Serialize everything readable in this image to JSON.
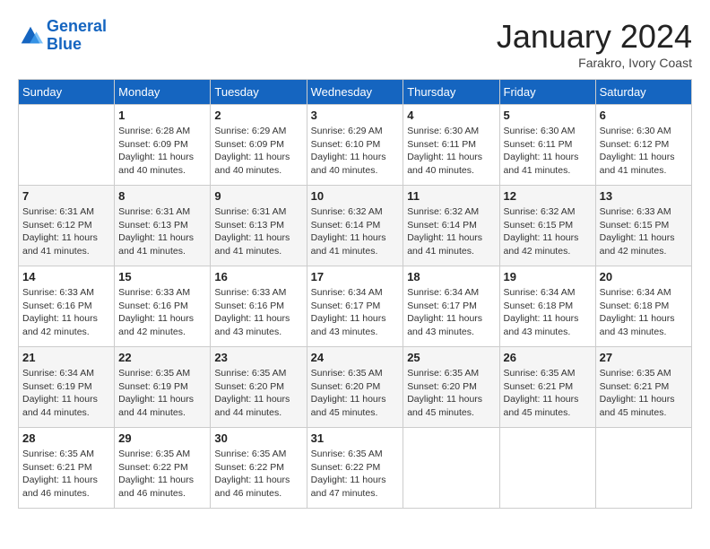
{
  "header": {
    "logo_line1": "General",
    "logo_line2": "Blue",
    "month": "January 2024",
    "location": "Farakro, Ivory Coast"
  },
  "days_of_week": [
    "Sunday",
    "Monday",
    "Tuesday",
    "Wednesday",
    "Thursday",
    "Friday",
    "Saturday"
  ],
  "weeks": [
    [
      {
        "day": "",
        "sunrise": "",
        "sunset": "",
        "daylight": ""
      },
      {
        "day": "1",
        "sunrise": "Sunrise: 6:28 AM",
        "sunset": "Sunset: 6:09 PM",
        "daylight": "Daylight: 11 hours and 40 minutes."
      },
      {
        "day": "2",
        "sunrise": "Sunrise: 6:29 AM",
        "sunset": "Sunset: 6:09 PM",
        "daylight": "Daylight: 11 hours and 40 minutes."
      },
      {
        "day": "3",
        "sunrise": "Sunrise: 6:29 AM",
        "sunset": "Sunset: 6:10 PM",
        "daylight": "Daylight: 11 hours and 40 minutes."
      },
      {
        "day": "4",
        "sunrise": "Sunrise: 6:30 AM",
        "sunset": "Sunset: 6:11 PM",
        "daylight": "Daylight: 11 hours and 40 minutes."
      },
      {
        "day": "5",
        "sunrise": "Sunrise: 6:30 AM",
        "sunset": "Sunset: 6:11 PM",
        "daylight": "Daylight: 11 hours and 41 minutes."
      },
      {
        "day": "6",
        "sunrise": "Sunrise: 6:30 AM",
        "sunset": "Sunset: 6:12 PM",
        "daylight": "Daylight: 11 hours and 41 minutes."
      }
    ],
    [
      {
        "day": "7",
        "sunrise": "Sunrise: 6:31 AM",
        "sunset": "Sunset: 6:12 PM",
        "daylight": "Daylight: 11 hours and 41 minutes."
      },
      {
        "day": "8",
        "sunrise": "Sunrise: 6:31 AM",
        "sunset": "Sunset: 6:13 PM",
        "daylight": "Daylight: 11 hours and 41 minutes."
      },
      {
        "day": "9",
        "sunrise": "Sunrise: 6:31 AM",
        "sunset": "Sunset: 6:13 PM",
        "daylight": "Daylight: 11 hours and 41 minutes."
      },
      {
        "day": "10",
        "sunrise": "Sunrise: 6:32 AM",
        "sunset": "Sunset: 6:14 PM",
        "daylight": "Daylight: 11 hours and 41 minutes."
      },
      {
        "day": "11",
        "sunrise": "Sunrise: 6:32 AM",
        "sunset": "Sunset: 6:14 PM",
        "daylight": "Daylight: 11 hours and 41 minutes."
      },
      {
        "day": "12",
        "sunrise": "Sunrise: 6:32 AM",
        "sunset": "Sunset: 6:15 PM",
        "daylight": "Daylight: 11 hours and 42 minutes."
      },
      {
        "day": "13",
        "sunrise": "Sunrise: 6:33 AM",
        "sunset": "Sunset: 6:15 PM",
        "daylight": "Daylight: 11 hours and 42 minutes."
      }
    ],
    [
      {
        "day": "14",
        "sunrise": "Sunrise: 6:33 AM",
        "sunset": "Sunset: 6:16 PM",
        "daylight": "Daylight: 11 hours and 42 minutes."
      },
      {
        "day": "15",
        "sunrise": "Sunrise: 6:33 AM",
        "sunset": "Sunset: 6:16 PM",
        "daylight": "Daylight: 11 hours and 42 minutes."
      },
      {
        "day": "16",
        "sunrise": "Sunrise: 6:33 AM",
        "sunset": "Sunset: 6:16 PM",
        "daylight": "Daylight: 11 hours and 43 minutes."
      },
      {
        "day": "17",
        "sunrise": "Sunrise: 6:34 AM",
        "sunset": "Sunset: 6:17 PM",
        "daylight": "Daylight: 11 hours and 43 minutes."
      },
      {
        "day": "18",
        "sunrise": "Sunrise: 6:34 AM",
        "sunset": "Sunset: 6:17 PM",
        "daylight": "Daylight: 11 hours and 43 minutes."
      },
      {
        "day": "19",
        "sunrise": "Sunrise: 6:34 AM",
        "sunset": "Sunset: 6:18 PM",
        "daylight": "Daylight: 11 hours and 43 minutes."
      },
      {
        "day": "20",
        "sunrise": "Sunrise: 6:34 AM",
        "sunset": "Sunset: 6:18 PM",
        "daylight": "Daylight: 11 hours and 43 minutes."
      }
    ],
    [
      {
        "day": "21",
        "sunrise": "Sunrise: 6:34 AM",
        "sunset": "Sunset: 6:19 PM",
        "daylight": "Daylight: 11 hours and 44 minutes."
      },
      {
        "day": "22",
        "sunrise": "Sunrise: 6:35 AM",
        "sunset": "Sunset: 6:19 PM",
        "daylight": "Daylight: 11 hours and 44 minutes."
      },
      {
        "day": "23",
        "sunrise": "Sunrise: 6:35 AM",
        "sunset": "Sunset: 6:20 PM",
        "daylight": "Daylight: 11 hours and 44 minutes."
      },
      {
        "day": "24",
        "sunrise": "Sunrise: 6:35 AM",
        "sunset": "Sunset: 6:20 PM",
        "daylight": "Daylight: 11 hours and 45 minutes."
      },
      {
        "day": "25",
        "sunrise": "Sunrise: 6:35 AM",
        "sunset": "Sunset: 6:20 PM",
        "daylight": "Daylight: 11 hours and 45 minutes."
      },
      {
        "day": "26",
        "sunrise": "Sunrise: 6:35 AM",
        "sunset": "Sunset: 6:21 PM",
        "daylight": "Daylight: 11 hours and 45 minutes."
      },
      {
        "day": "27",
        "sunrise": "Sunrise: 6:35 AM",
        "sunset": "Sunset: 6:21 PM",
        "daylight": "Daylight: 11 hours and 45 minutes."
      }
    ],
    [
      {
        "day": "28",
        "sunrise": "Sunrise: 6:35 AM",
        "sunset": "Sunset: 6:21 PM",
        "daylight": "Daylight: 11 hours and 46 minutes."
      },
      {
        "day": "29",
        "sunrise": "Sunrise: 6:35 AM",
        "sunset": "Sunset: 6:22 PM",
        "daylight": "Daylight: 11 hours and 46 minutes."
      },
      {
        "day": "30",
        "sunrise": "Sunrise: 6:35 AM",
        "sunset": "Sunset: 6:22 PM",
        "daylight": "Daylight: 11 hours and 46 minutes."
      },
      {
        "day": "31",
        "sunrise": "Sunrise: 6:35 AM",
        "sunset": "Sunset: 6:22 PM",
        "daylight": "Daylight: 11 hours and 47 minutes."
      },
      {
        "day": "",
        "sunrise": "",
        "sunset": "",
        "daylight": ""
      },
      {
        "day": "",
        "sunrise": "",
        "sunset": "",
        "daylight": ""
      },
      {
        "day": "",
        "sunrise": "",
        "sunset": "",
        "daylight": ""
      }
    ]
  ]
}
